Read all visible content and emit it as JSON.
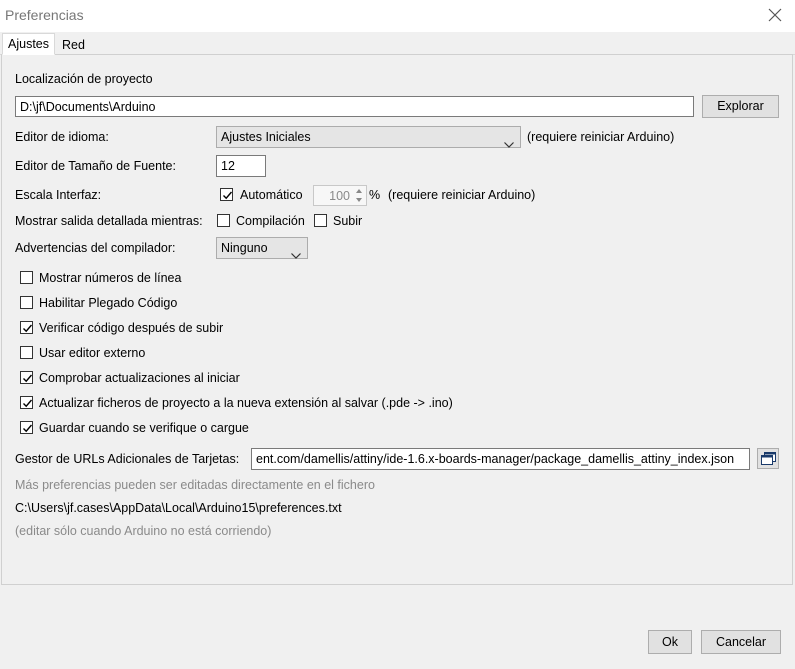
{
  "window": {
    "title": "Preferencias"
  },
  "tabs": [
    {
      "label": "Ajustes"
    },
    {
      "label": "Red"
    }
  ],
  "sketchbook": {
    "label": "Localización de proyecto",
    "value": "D:\\jf\\Documents\\Arduino",
    "browse_label": "Explorar"
  },
  "language": {
    "label": "Editor de idioma:",
    "value": "Ajustes Iniciales",
    "note": "(requiere reiniciar Arduino)"
  },
  "font_size": {
    "label": "Editor de Tamaño de Fuente:",
    "value": "12"
  },
  "scale": {
    "label": "Escala Interfaz:",
    "auto_label": "Automático",
    "auto_checked": true,
    "value": "100",
    "unit": "%",
    "note": "(requiere reiniciar Arduino)"
  },
  "verbose": {
    "label": "Mostrar salida detallada mientras:",
    "compile_label": "Compilación",
    "compile_checked": false,
    "upload_label": "Subir",
    "upload_checked": false
  },
  "warnings": {
    "label": "Advertencias del compilador:",
    "value": "Ninguno"
  },
  "options": [
    {
      "label": "Mostrar números de línea",
      "checked": false
    },
    {
      "label": "Habilitar Plegado Código",
      "checked": false
    },
    {
      "label": "Verificar código después de subir",
      "checked": true
    },
    {
      "label": "Usar editor externo",
      "checked": false
    },
    {
      "label": "Comprobar actualizaciones al iniciar",
      "checked": true
    },
    {
      "label": "Actualizar ficheros de proyecto a la nueva extensión al salvar (.pde -> .ino)",
      "checked": true
    },
    {
      "label": "Guardar cuando se verifique o cargue",
      "checked": true
    }
  ],
  "boards_url": {
    "label": "Gestor de URLs Adicionales de Tarjetas:",
    "value": "ent.com/damellis/attiny/ide-1.6.x-boards-manager/package_damellis_attiny_index.json"
  },
  "info": {
    "more": "Más preferencias pueden ser editadas directamente en el fichero",
    "path": "C:\\Users\\jf.cases\\AppData\\Local\\Arduino15\\preferences.txt",
    "note": "(editar sólo cuando Arduino no está corriendo)"
  },
  "buttons": {
    "ok": "Ok",
    "cancel": "Cancelar"
  },
  "colors": {
    "window_bg": "#f0f0f0",
    "title_text": "#777777",
    "hint_text": "#8a8a8a"
  }
}
